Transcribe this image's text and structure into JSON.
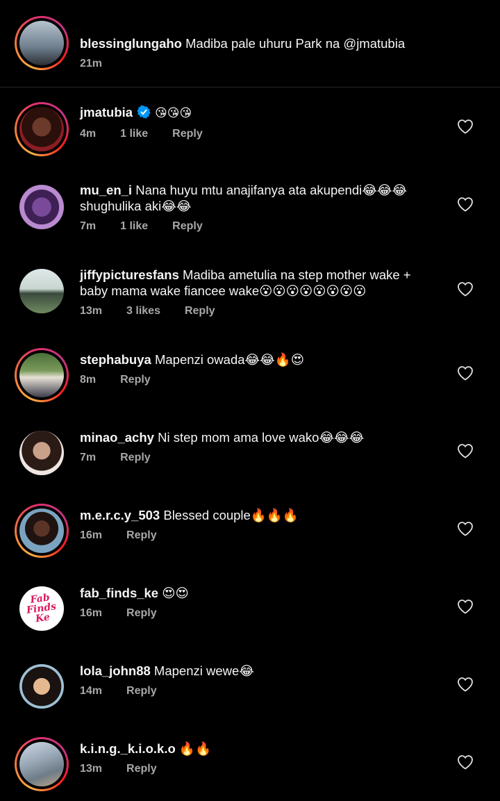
{
  "caption": {
    "username": "blessinglungaho",
    "text": "Madiba pale uhuru Park na @jmatubia",
    "time": "21m"
  },
  "comments": [
    {
      "username": "jmatubia",
      "verified": true,
      "text": "😘😘😘",
      "time": "4m",
      "likes": "1 like",
      "reply": "Reply"
    },
    {
      "username": "mu_en_i",
      "text": "Nana huyu mtu anajifanya ata akupendi😂😂😂",
      "text2": "shughulika aki😂😂",
      "time": "7m",
      "likes": "1 like",
      "reply": "Reply"
    },
    {
      "username": "jiffypicturesfans",
      "text": "Madiba ametulia  na step mother wake +",
      "text2": "baby mama wake fiancee  wake😮😮😮😮😮😮😮😮",
      "time": "13m",
      "likes": "3 likes",
      "reply": "Reply"
    },
    {
      "username": "stephabuya",
      "text": "Mapenzi owada😂😂🔥😍",
      "time": "8m",
      "reply": "Reply"
    },
    {
      "username": "minao_achy",
      "text": "Ni step mom ama love wako😂😂😂",
      "time": "7m",
      "reply": "Reply"
    },
    {
      "username": "m.e.r.c.y_503",
      "text": "Blessed couple🔥🔥🔥",
      "time": "16m",
      "reply": "Reply"
    },
    {
      "username": "fab_finds_ke",
      "text": "😍😍",
      "time": "16m",
      "reply": "Reply",
      "avatar_text": "Fab Finds Ke"
    },
    {
      "username": "lola_john88",
      "text": "Mapenzi wewe😂",
      "time": "14m",
      "reply": "Reply"
    },
    {
      "username": "k.i.n.g._k.i.o.k.o",
      "text": "🔥🔥",
      "time": "13m",
      "reply": "Reply"
    }
  ],
  "colors": {
    "background": "#000000",
    "meta_text": "#a8a8a8",
    "verified_blue": "#0095f6"
  },
  "icons": {
    "like": "heart-outline-icon",
    "verified": "verified-badge-icon"
  }
}
